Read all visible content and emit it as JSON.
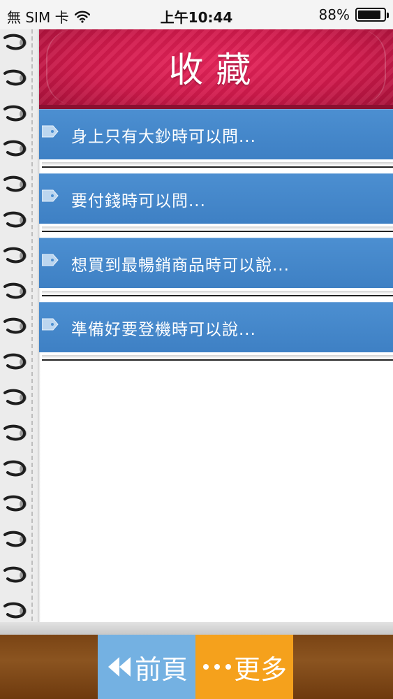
{
  "status_bar": {
    "carrier": "無 SIM 卡",
    "time": "上午10:44",
    "battery": "88%",
    "battery_level": 0.88,
    "wifi_icon": "wifi-icon"
  },
  "header": {
    "title": "收藏"
  },
  "favorites": {
    "items": [
      {
        "label": "身上只有大鈔時可以問..."
      },
      {
        "label": "要付錢時可以問..."
      },
      {
        "label": "想買到最暢銷商品時可以說..."
      },
      {
        "label": "準備好要登機時可以說..."
      }
    ]
  },
  "toolbar": {
    "prev_label": "前頁",
    "prev_icon": "double-chevron-left-icon",
    "more_label": "更多",
    "more_icon": "ellipsis-icon"
  },
  "colors": {
    "banner": "#d01a4c",
    "item": "#4287c8",
    "prev_button": "#74b1e2",
    "more_button": "#f5a11c",
    "toolbar": "#7f4818"
  }
}
